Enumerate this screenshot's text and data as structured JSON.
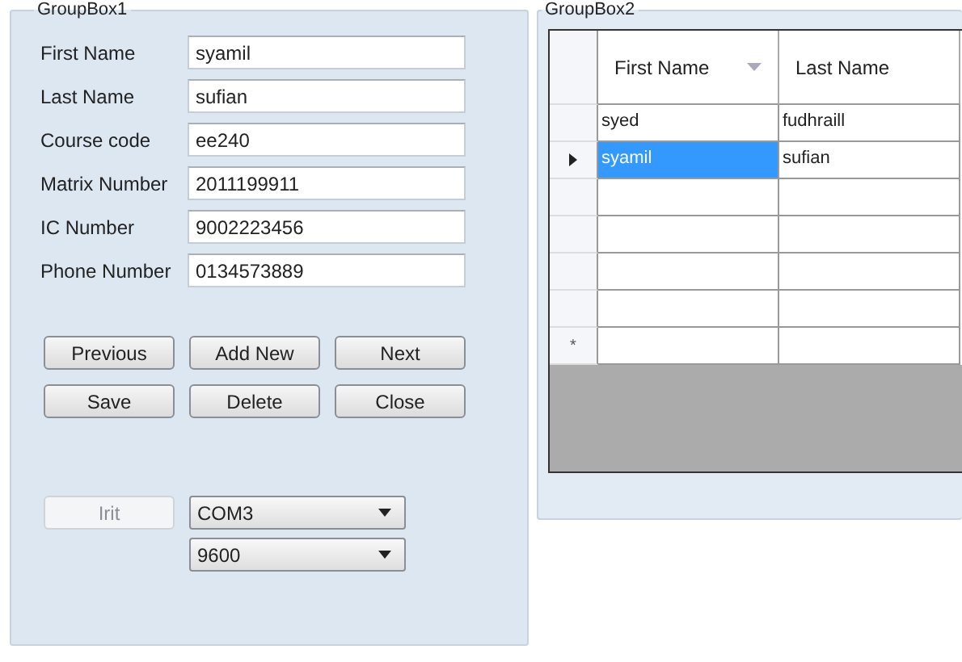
{
  "group_box_1": {
    "title": "GroupBox1",
    "fields": [
      {
        "label": "First Name",
        "value": "syamil"
      },
      {
        "label": "Last Name",
        "value": "sufian"
      },
      {
        "label": "Course code",
        "value": "ee240"
      },
      {
        "label": "Matrix Number",
        "value": "2011199911"
      },
      {
        "label": "IC Number",
        "value": "9002223456"
      },
      {
        "label": "Phone Number",
        "value": "0134573889"
      }
    ],
    "buttons": [
      {
        "label": "Previous"
      },
      {
        "label": "Add New"
      },
      {
        "label": "Next"
      },
      {
        "label": "Save"
      },
      {
        "label": "Delete"
      },
      {
        "label": "Close"
      }
    ],
    "init_button": {
      "label": "Irit",
      "disabled": true
    },
    "dropdowns": [
      {
        "value": "COM3"
      },
      {
        "value": "9600"
      }
    ]
  },
  "group_box_2": {
    "title": "GroupBox2",
    "table": {
      "columns": [
        "First Name",
        "Last Name"
      ],
      "rows": [
        {
          "cells": [
            "syed",
            "fudhraill"
          ],
          "selected": false
        },
        {
          "cells": [
            "syamil",
            "sufian"
          ],
          "selected": true
        }
      ],
      "new_row_marker": "*"
    }
  }
}
